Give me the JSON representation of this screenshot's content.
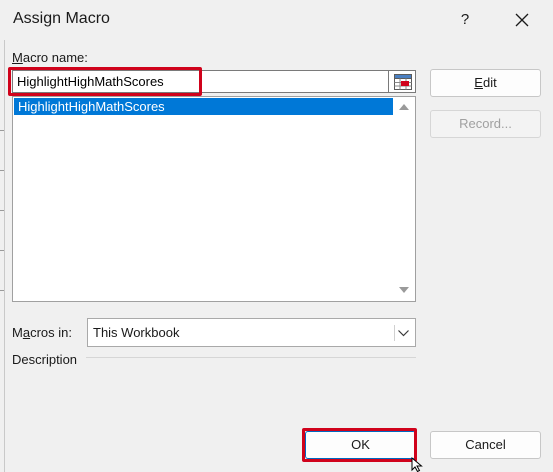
{
  "dialog": {
    "title": "Assign Macro",
    "help_label": "?"
  },
  "macro_name": {
    "label_prefix": "",
    "label_accel": "M",
    "label_rest": "acro name:",
    "value": "HighlightHighMathScores"
  },
  "macro_list": {
    "items": [
      "HighlightHighMathScores"
    ],
    "selected_index": 0
  },
  "buttons": {
    "edit_accel": "E",
    "edit_rest": "dit",
    "record": "Record...",
    "ok": "OK",
    "cancel": "Cancel"
  },
  "macros_in": {
    "label_prefix": "M",
    "label_accel": "a",
    "label_rest": "cros in:",
    "value": "This Workbook"
  },
  "description": {
    "label": "Description"
  },
  "colors": {
    "selection": "#0078d7",
    "highlight_box": "#d0021b"
  },
  "icons": {
    "close": "close-icon",
    "ref": "cell-reference-icon",
    "scroll_up": "chevron-up-icon",
    "scroll_down": "chevron-down-icon",
    "dropdown": "chevron-down-icon",
    "cursor": "mouse-pointer-icon"
  }
}
